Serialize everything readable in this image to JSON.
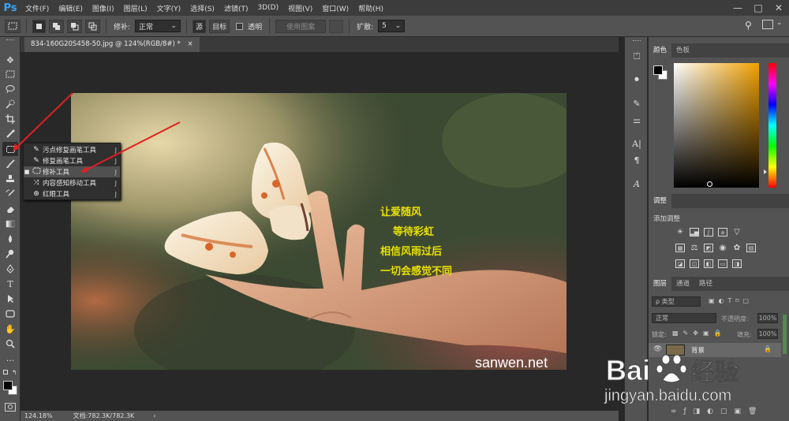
{
  "app": {
    "logo": "Ps"
  },
  "menu": [
    "文件(F)",
    "编辑(E)",
    "图像(I)",
    "图层(L)",
    "文字(Y)",
    "选择(S)",
    "滤镜(T)",
    "3D(D)",
    "视图(V)",
    "窗口(W)",
    "帮助(H)"
  ],
  "window_controls": {
    "minimize": "—",
    "maximize": "□",
    "close": "✕"
  },
  "options": {
    "patch_label": "修补:",
    "patch_value": "正常",
    "source": "源",
    "target": "目标",
    "transparent": "透明",
    "use_pattern": "使用图案",
    "diffusion_label": "扩散:",
    "diffusion_value": "5"
  },
  "document": {
    "tab_title": "834-160G20S458-50.jpg @ 124%(RGB/8#) *",
    "close": "×"
  },
  "flyout": {
    "items": [
      {
        "label": "污点修复画笔工具",
        "key": "J",
        "icon": "spot-healing-brush-icon",
        "selected": false
      },
      {
        "label": "修复画笔工具",
        "key": "J",
        "icon": "healing-brush-icon",
        "selected": false
      },
      {
        "label": "修补工具",
        "key": "J",
        "icon": "patch-icon",
        "selected": true
      },
      {
        "label": "内容感知移动工具",
        "key": "J",
        "icon": "content-aware-move-icon",
        "selected": false
      },
      {
        "label": "红眼工具",
        "key": "J",
        "icon": "red-eye-icon",
        "selected": false
      }
    ]
  },
  "photo": {
    "poem": [
      "让爱随风",
      "等待彩虹",
      "相信风雨过后",
      "一切会感觉不同"
    ],
    "site": "sanwen.net"
  },
  "status": {
    "zoom": "124.18%",
    "doc": "文档:782.3K/782.3K",
    "arrow": "›"
  },
  "color_panel": {
    "tabs": [
      "颜色",
      "色板"
    ]
  },
  "adjust_panel": {
    "tab": "调整",
    "add_label": "添加调整"
  },
  "layers_panel": {
    "tabs": [
      "图层",
      "通道",
      "路径"
    ],
    "kind": "ρ 类型",
    "blend": "正常",
    "opacity_label": "不透明度:",
    "opacity_value": "100%",
    "lock_label": "锁定:",
    "fill_label": "填充:",
    "fill_value": "100%",
    "layer_name": "背景"
  },
  "watermark": {
    "brand": "Bai",
    "brand2": "经验",
    "url": "jingyan.baidu.com"
  },
  "colors": {
    "accent": "#31a8ff",
    "poem": "#e8e000",
    "annotation": "#e02020"
  }
}
